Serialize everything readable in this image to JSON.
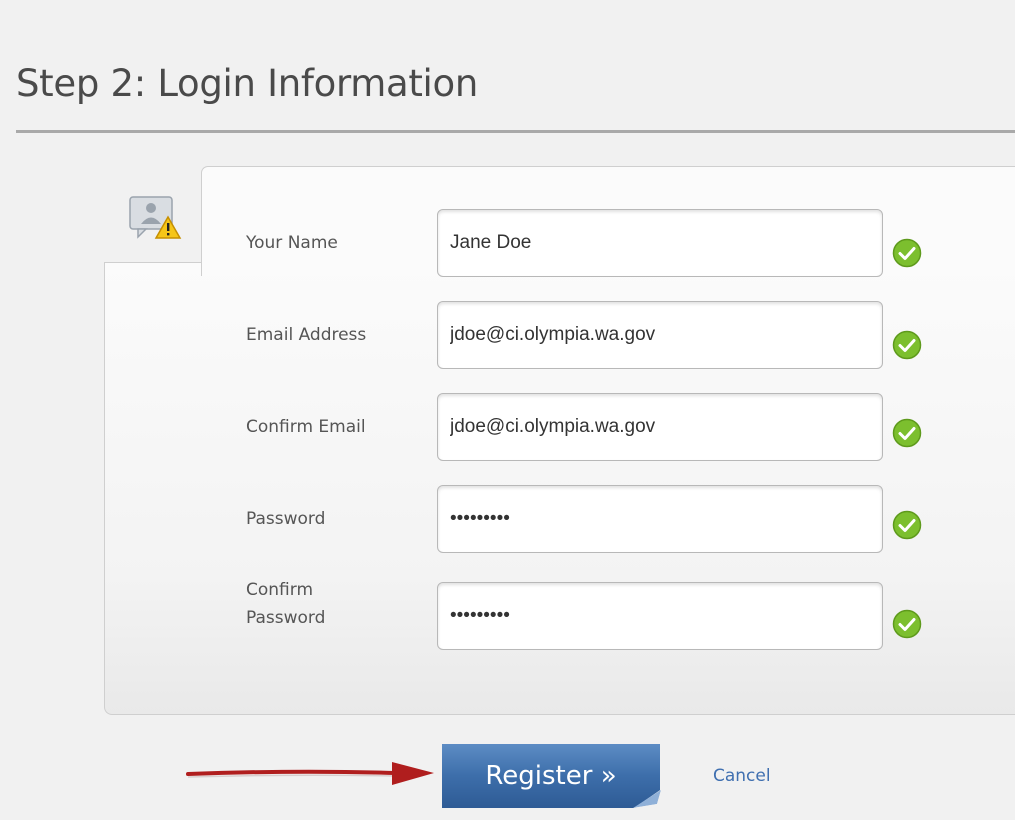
{
  "page": {
    "title": "Step 2: Login Information"
  },
  "form": {
    "fields": [
      {
        "label": "Your Name",
        "value": "Jane Doe",
        "type": "text",
        "valid": true
      },
      {
        "label": "Email Address",
        "value": "jdoe@ci.olympia.wa.gov",
        "type": "text",
        "valid": true
      },
      {
        "label": "Confirm Email",
        "value": "jdoe@ci.olympia.wa.gov",
        "type": "text",
        "valid": true
      },
      {
        "label": "Password",
        "value": "pass12345",
        "type": "password",
        "valid": true
      },
      {
        "label": "Confirm\nPassword",
        "value": "pass12345",
        "type": "password",
        "valid": true
      }
    ]
  },
  "actions": {
    "register_label": "Register »",
    "cancel_label": "Cancel"
  },
  "icons": {
    "form": "user-warning-icon",
    "valid": "checkmark-icon",
    "pointer": "red-arrow-icon"
  },
  "colors": {
    "check_green": "#7cbf2e",
    "button_blue": "#3d6eaa",
    "arrow_red": "#b01e1e",
    "link_blue": "#3f6fb0"
  }
}
